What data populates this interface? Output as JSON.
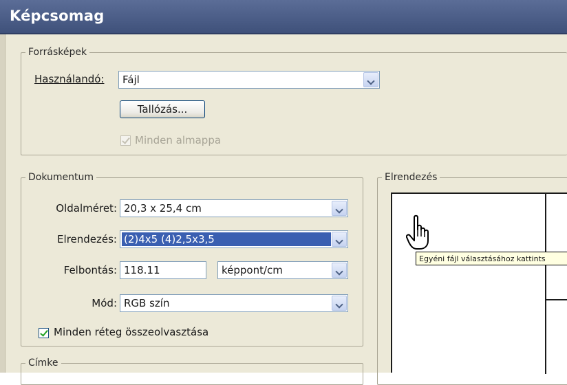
{
  "window": {
    "title": "Képcsomag"
  },
  "source": {
    "legend": "Forrásképek",
    "use_label": "Használandó:",
    "use_value": "Fájl",
    "browse_label": "Tallózás...",
    "subfolders_label": "Minden almappa",
    "subfolders_checked": true,
    "subfolders_enabled": false
  },
  "document": {
    "legend": "Dokumentum",
    "page_size_label": "Oldalméret:",
    "page_size_value": "20,3 x 25,4 cm",
    "layout_label": "Elrendezés:",
    "layout_value": "(2)4x5 (4)2,5x3,5",
    "resolution_label": "Felbontás:",
    "resolution_value": "118.11",
    "resolution_unit": "képpont/cm",
    "mode_label": "Mód:",
    "mode_value": "RGB szín",
    "flatten_label": "Minden réteg összeolvasztása",
    "flatten_checked": true
  },
  "label_group": {
    "legend": "Címke"
  },
  "layout_preview": {
    "legend": "Elrendezés",
    "tooltip": "Egyéni fájl választásához kattints"
  }
}
